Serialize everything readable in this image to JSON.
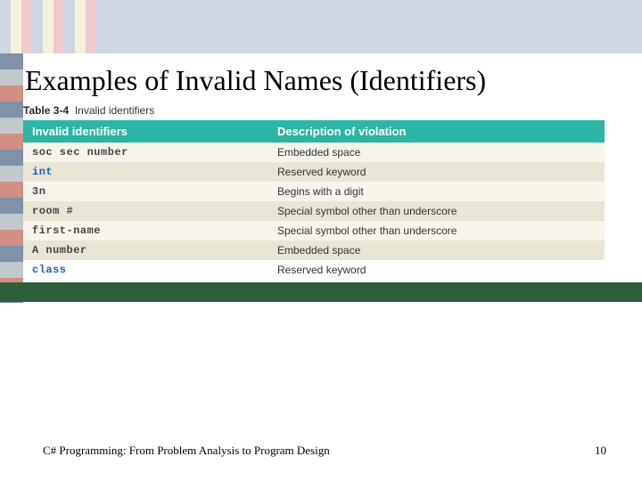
{
  "title": "Examples of Invalid Names (Identifiers)",
  "caption": {
    "label": "Table 3-4",
    "text": "Invalid identifiers"
  },
  "headers": {
    "col1": "Invalid identifiers",
    "col2": "Description of violation"
  },
  "rows": [
    {
      "id": "soc sec number",
      "desc": "Embedded space",
      "kw": false
    },
    {
      "id": "int",
      "desc": "Reserved keyword",
      "kw": true
    },
    {
      "id": "3n",
      "desc": "Begins with a digit",
      "kw": false
    },
    {
      "id": "room #",
      "desc": "Special symbol other than underscore",
      "kw": false
    },
    {
      "id": "first-name",
      "desc": "Special symbol other than underscore",
      "kw": false
    },
    {
      "id": "A number",
      "desc": "Embedded space",
      "kw": false
    },
    {
      "id": "class",
      "desc": "Reserved keyword",
      "kw": true
    }
  ],
  "footer": {
    "book": "C# Programming: From Problem Analysis to Program Design",
    "page": "10"
  }
}
